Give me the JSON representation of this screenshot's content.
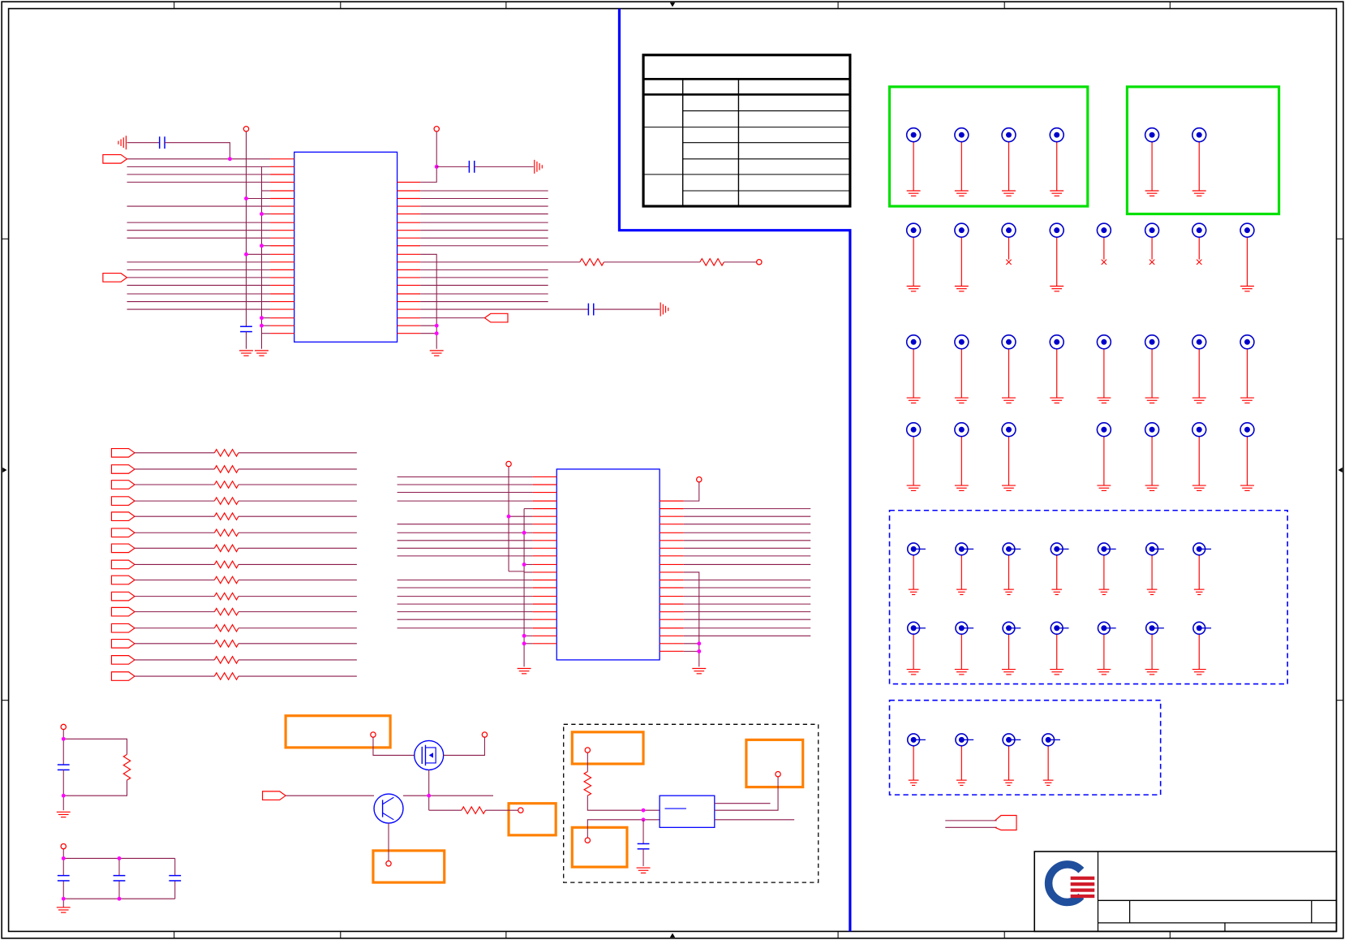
{
  "colors": {
    "frame": "#000000",
    "wire": "#8b1a4a",
    "pin": "#ff0000",
    "ic_outline": "#0000ff",
    "sheet_divider": "#0000ff",
    "test_point": "#0000cc",
    "highlight_green": "#00e000",
    "highlight_orange": "#ff8000",
    "junction": "#ff00ff",
    "logo_blue": "#1f4e9c",
    "logo_red": "#d11a2a"
  },
  "title_block": {
    "logo_icon": "company-logo"
  },
  "icons": [
    "test-point-icon",
    "ground-icon",
    "chassis-ground-icon",
    "resistor-icon",
    "capacitor-icon",
    "port-icon",
    "mosfet-icon",
    "bjt-icon",
    "power-node-icon"
  ]
}
